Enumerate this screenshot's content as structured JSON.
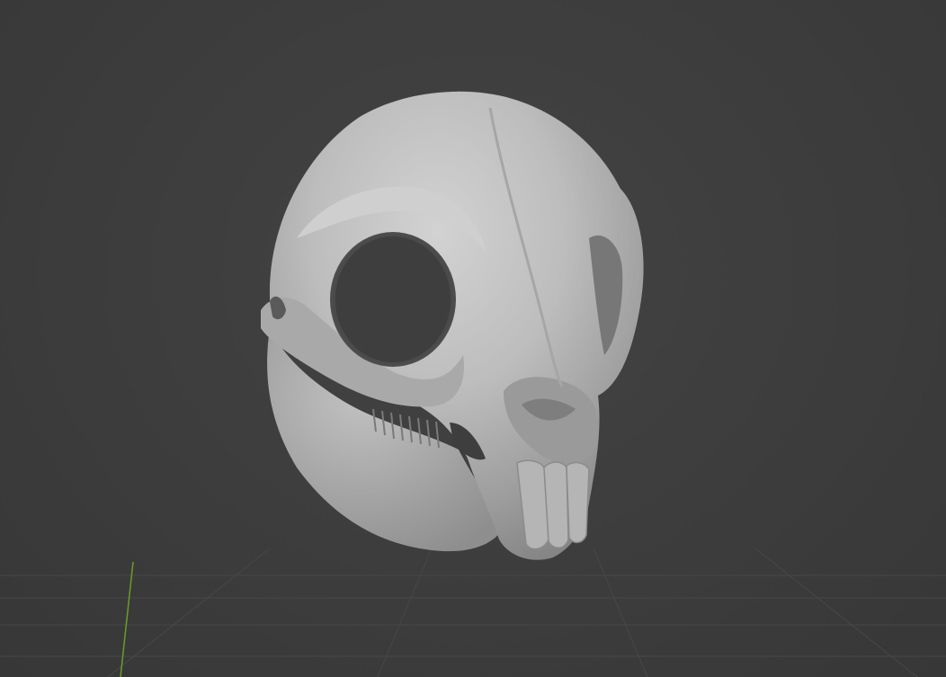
{
  "viewport": {
    "mode": "3d-viewport",
    "background_color": "#3d3d3d",
    "grid_color": "#454545",
    "y_axis_color": "#6a9c2a"
  },
  "model": {
    "name": "sculpted-skull",
    "material_color": "#b9b9b9",
    "shading": "solid-matcap"
  }
}
